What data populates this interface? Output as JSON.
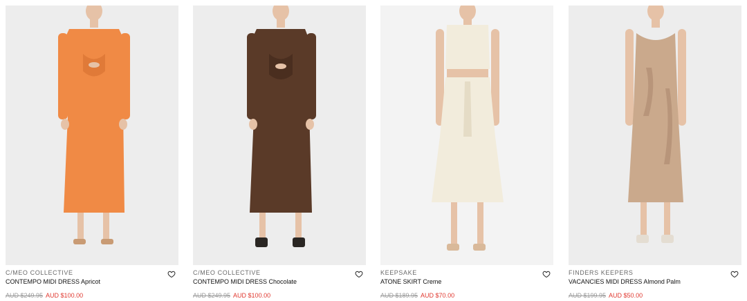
{
  "products": [
    {
      "brand": "C/MEO COLLECTIVE",
      "title": "CONTEMPO MIDI DRESS Apricot",
      "was_price": "AUD $249.95",
      "sale_price": "AUD $100.00",
      "dress_color": "#f08a45",
      "dress_shade": "#e07a38",
      "shoe_color": "#c99b74"
    },
    {
      "brand": "C/MEO COLLECTIVE",
      "title": "CONTEMPO MIDI DRESS Chocolate",
      "was_price": "AUD $249.95",
      "sale_price": "AUD $100.00",
      "dress_color": "#5a3a28",
      "dress_shade": "#4a2e1f",
      "shoe_color": "#2a2623"
    },
    {
      "brand": "KEEPSAKE",
      "title": "ATONE SKIRT Creme",
      "was_price": "AUD $189.95",
      "sale_price": "AUD $70.00",
      "dress_color": "#f2ecdc",
      "dress_shade": "#e5dcc6",
      "shoe_color": "#d9b99a"
    },
    {
      "brand": "FINDERS KEEPERS",
      "title": "VACANCIES MIDI DRESS Almond Palm",
      "was_price": "AUD $199.95",
      "sale_price": "AUD $50.00",
      "dress_color": "#caa98c",
      "dress_shade": "#b8957a",
      "shoe_color": "#e4ddd2"
    }
  ],
  "colors": {
    "sale_red": "#e0382f",
    "skin": "#e6c2a7"
  },
  "icons": {
    "wishlist": "heart-outline-icon"
  }
}
